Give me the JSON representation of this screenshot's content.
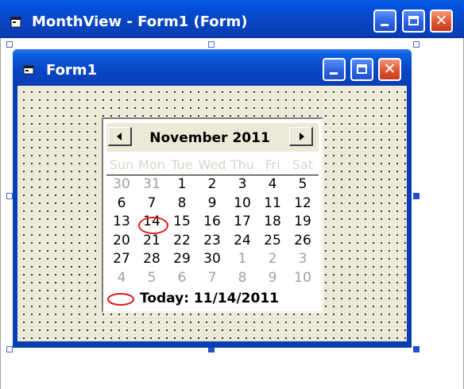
{
  "outer_window": {
    "title": "MonthView - Form1 (Form)",
    "close_glyph": "✕"
  },
  "form": {
    "title": "Form1",
    "close_glyph": "✕"
  },
  "monthview": {
    "month_title": "November 2011",
    "weekdays": [
      "Sun",
      "Mon",
      "Tue",
      "Wed",
      "Thu",
      "Fri",
      "Sat"
    ],
    "weeks": [
      [
        "30",
        "31",
        "1",
        "2",
        "3",
        "4",
        "5"
      ],
      [
        "6",
        "7",
        "8",
        "9",
        "10",
        "11",
        "12"
      ],
      [
        "13",
        "14",
        "15",
        "16",
        "17",
        "18",
        "19"
      ],
      [
        "20",
        "21",
        "22",
        "23",
        "24",
        "25",
        "26"
      ],
      [
        "27",
        "28",
        "29",
        "30",
        "1",
        "2",
        "3"
      ],
      [
        "4",
        "5",
        "6",
        "7",
        "8",
        "9",
        "10"
      ]
    ],
    "today_label": "Today: 11/14/2011",
    "today_day": "14"
  },
  "colors": {
    "titlebar_blue": "#0a46c6",
    "close_red": "#e0542f",
    "today_circle": "#e01a1a",
    "form_background": "#ece9d8"
  }
}
